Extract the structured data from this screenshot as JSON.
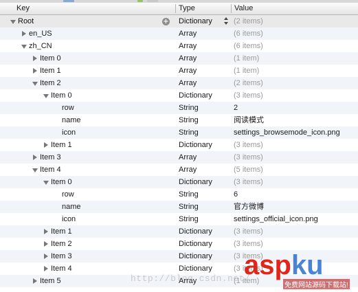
{
  "header": {
    "key": "Key",
    "type": "Type",
    "value": "Value"
  },
  "rows": [
    {
      "key": "Root",
      "type": "Dictionary",
      "value": "(2 items)",
      "expander": "down",
      "dim": true
    },
    {
      "key": "en_US",
      "type": "Array",
      "value": "(6 items)",
      "expander": "right",
      "dim": true
    },
    {
      "key": "zh_CN",
      "type": "Array",
      "value": "(6 items)",
      "expander": "down",
      "dim": true
    },
    {
      "key": "Item 0",
      "type": "Array",
      "value": "(1 item)",
      "expander": "right",
      "dim": true
    },
    {
      "key": "Item 1",
      "type": "Array",
      "value": "(1 item)",
      "expander": "right",
      "dim": true
    },
    {
      "key": "Item 2",
      "type": "Array",
      "value": "(2 items)",
      "expander": "down",
      "dim": true
    },
    {
      "key": "Item 0",
      "type": "Dictionary",
      "value": "(3 items)",
      "expander": "down",
      "dim": true
    },
    {
      "key": "row",
      "type": "String",
      "value": "2",
      "expander": "none",
      "dim": false
    },
    {
      "key": "name",
      "type": "String",
      "value": "阅读模式",
      "expander": "none",
      "dim": false
    },
    {
      "key": "icon",
      "type": "String",
      "value": "settings_browsemode_icon.png",
      "expander": "none",
      "dim": false
    },
    {
      "key": "Item 1",
      "type": "Dictionary",
      "value": "(3 items)",
      "expander": "right",
      "dim": true
    },
    {
      "key": "Item 3",
      "type": "Array",
      "value": "(3 items)",
      "expander": "right",
      "dim": true
    },
    {
      "key": "Item 4",
      "type": "Array",
      "value": "(5 items)",
      "expander": "down",
      "dim": true
    },
    {
      "key": "Item 0",
      "type": "Dictionary",
      "value": "(3 items)",
      "expander": "down",
      "dim": true
    },
    {
      "key": "row",
      "type": "String",
      "value": "6",
      "expander": "none",
      "dim": false
    },
    {
      "key": "name",
      "type": "String",
      "value": "官方微博",
      "expander": "none",
      "dim": false
    },
    {
      "key": "icon",
      "type": "String",
      "value": "settings_official_icon.png",
      "expander": "none",
      "dim": false
    },
    {
      "key": "Item 1",
      "type": "Dictionary",
      "value": "(3 items)",
      "expander": "right",
      "dim": true
    },
    {
      "key": "Item 2",
      "type": "Dictionary",
      "value": "(3 items)",
      "expander": "right",
      "dim": true
    },
    {
      "key": "Item 3",
      "type": "Dictionary",
      "value": "(3 items)",
      "expander": "right",
      "dim": true
    },
    {
      "key": "Item 4",
      "type": "Dictionary",
      "value": "(3 items)",
      "expander": "right",
      "dim": true
    },
    {
      "key": "Item 5",
      "type": "Array",
      "value": "(1 item)",
      "expander": "right",
      "dim": true
    }
  ],
  "root_controls": {
    "add_icon": "plus-circle-icon",
    "add_symbol": "+",
    "type_stepper_icon": "up-down-arrows-icon"
  },
  "watermark": {
    "url": "http://blog.csdn.net/",
    "logo_asp": "asp",
    "logo_ku": "ku",
    "logo_tag": "免费网站源码下载站!"
  },
  "colors": {
    "alt_row": "#f1f5fa",
    "dim_text": "#9a9a9a",
    "logo_red": "#e0251b",
    "logo_blue": "#2a6fcf"
  }
}
